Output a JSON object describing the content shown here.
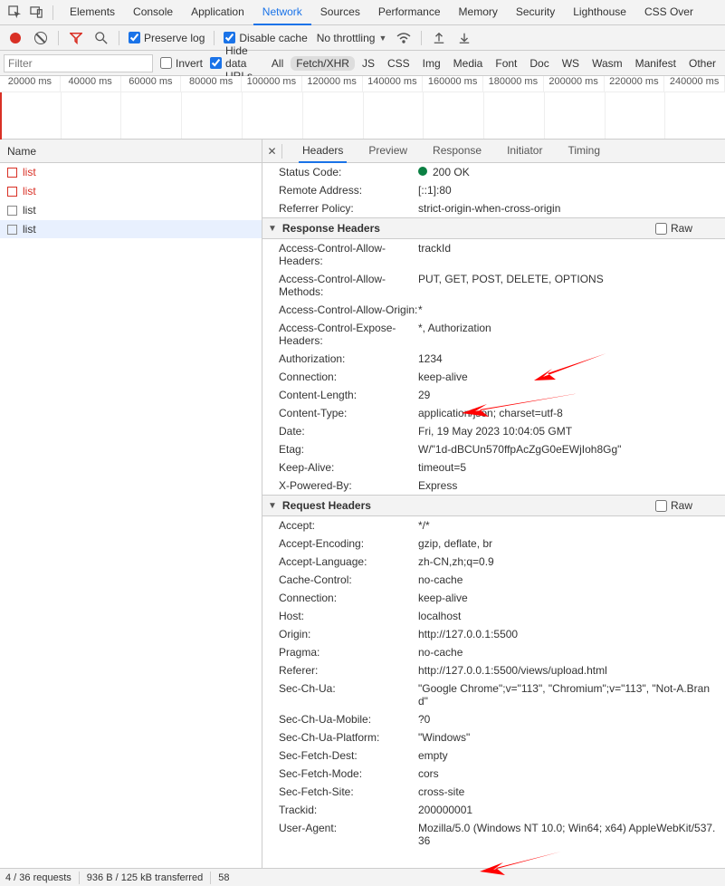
{
  "top_tabs": [
    "Elements",
    "Console",
    "Application",
    "Network",
    "Sources",
    "Performance",
    "Memory",
    "Security",
    "Lighthouse",
    "CSS Over"
  ],
  "top_tabs_active_index": 3,
  "toolbar": {
    "preserve_log": "Preserve log",
    "disable_cache": "Disable cache",
    "throttling": "No throttling"
  },
  "filterbar": {
    "filter_placeholder": "Filter",
    "invert": "Invert",
    "hide_urls": "Hide data URLs",
    "pills": [
      "All",
      "Fetch/XHR",
      "JS",
      "CSS",
      "Img",
      "Media",
      "Font",
      "Doc",
      "WS",
      "Wasm",
      "Manifest",
      "Other"
    ],
    "active_pill": "Fetch/XHR"
  },
  "timeline_ticks": [
    "20000 ms",
    "40000 ms",
    "60000 ms",
    "80000 ms",
    "100000 ms",
    "120000 ms",
    "140000 ms",
    "160000 ms",
    "180000 ms",
    "200000 ms",
    "220000 ms",
    "240000 ms"
  ],
  "left": {
    "header": "Name",
    "rows": [
      {
        "label": "list",
        "red": true
      },
      {
        "label": "list",
        "red": true
      },
      {
        "label": "list",
        "red": false
      },
      {
        "label": "list",
        "red": false,
        "sel": true
      }
    ]
  },
  "detail_tabs": [
    "Headers",
    "Preview",
    "Response",
    "Initiator",
    "Timing"
  ],
  "detail_tabs_active_index": 0,
  "general": [
    {
      "k": "Status Code:",
      "v": "200 OK",
      "dot": true
    },
    {
      "k": "Remote Address:",
      "v": "[::1]:80"
    },
    {
      "k": "Referrer Policy:",
      "v": "strict-origin-when-cross-origin"
    }
  ],
  "sections": {
    "response_headers_title": "Response Headers",
    "request_headers_title": "Request Headers",
    "raw_label": "Raw"
  },
  "response_headers": [
    {
      "k": "Access-Control-Allow-Headers:",
      "v": "trackId"
    },
    {
      "k": "Access-Control-Allow-Methods:",
      "v": "PUT, GET, POST, DELETE, OPTIONS"
    },
    {
      "k": "Access-Control-Allow-Origin:",
      "v": "*"
    },
    {
      "k": "Access-Control-Expose-Headers:",
      "v": "*, Authorization"
    },
    {
      "k": "Authorization:",
      "v": "1234"
    },
    {
      "k": "Connection:",
      "v": "keep-alive"
    },
    {
      "k": "Content-Length:",
      "v": "29"
    },
    {
      "k": "Content-Type:",
      "v": "application/json; charset=utf-8"
    },
    {
      "k": "Date:",
      "v": "Fri, 19 May 2023 10:04:05 GMT"
    },
    {
      "k": "Etag:",
      "v": "W/\"1d-dBCUn570ffpAcZgG0eEWjIoh8Gg\""
    },
    {
      "k": "Keep-Alive:",
      "v": "timeout=5"
    },
    {
      "k": "X-Powered-By:",
      "v": "Express"
    }
  ],
  "request_headers": [
    {
      "k": "Accept:",
      "v": "*/*"
    },
    {
      "k": "Accept-Encoding:",
      "v": "gzip, deflate, br"
    },
    {
      "k": "Accept-Language:",
      "v": "zh-CN,zh;q=0.9"
    },
    {
      "k": "Cache-Control:",
      "v": "no-cache"
    },
    {
      "k": "Connection:",
      "v": "keep-alive"
    },
    {
      "k": "Host:",
      "v": "localhost"
    },
    {
      "k": "Origin:",
      "v": "http://127.0.0.1:5500"
    },
    {
      "k": "Pragma:",
      "v": "no-cache"
    },
    {
      "k": "Referer:",
      "v": "http://127.0.0.1:5500/views/upload.html"
    },
    {
      "k": "Sec-Ch-Ua:",
      "v": "\"Google Chrome\";v=\"113\", \"Chromium\";v=\"113\", \"Not-A.Brand\""
    },
    {
      "k": "Sec-Ch-Ua-Mobile:",
      "v": "?0"
    },
    {
      "k": "Sec-Ch-Ua-Platform:",
      "v": "\"Windows\""
    },
    {
      "k": "Sec-Fetch-Dest:",
      "v": "empty"
    },
    {
      "k": "Sec-Fetch-Mode:",
      "v": "cors"
    },
    {
      "k": "Sec-Fetch-Site:",
      "v": "cross-site"
    },
    {
      "k": "Trackid:",
      "v": "200000001"
    },
    {
      "k": "User-Agent:",
      "v": "Mozilla/5.0 (Windows NT 10.0; Win64; x64) AppleWebKit/537.36"
    }
  ],
  "status": {
    "requests": "4 / 36 requests",
    "transfer": "936 B / 125 kB transferred",
    "more": "58"
  }
}
